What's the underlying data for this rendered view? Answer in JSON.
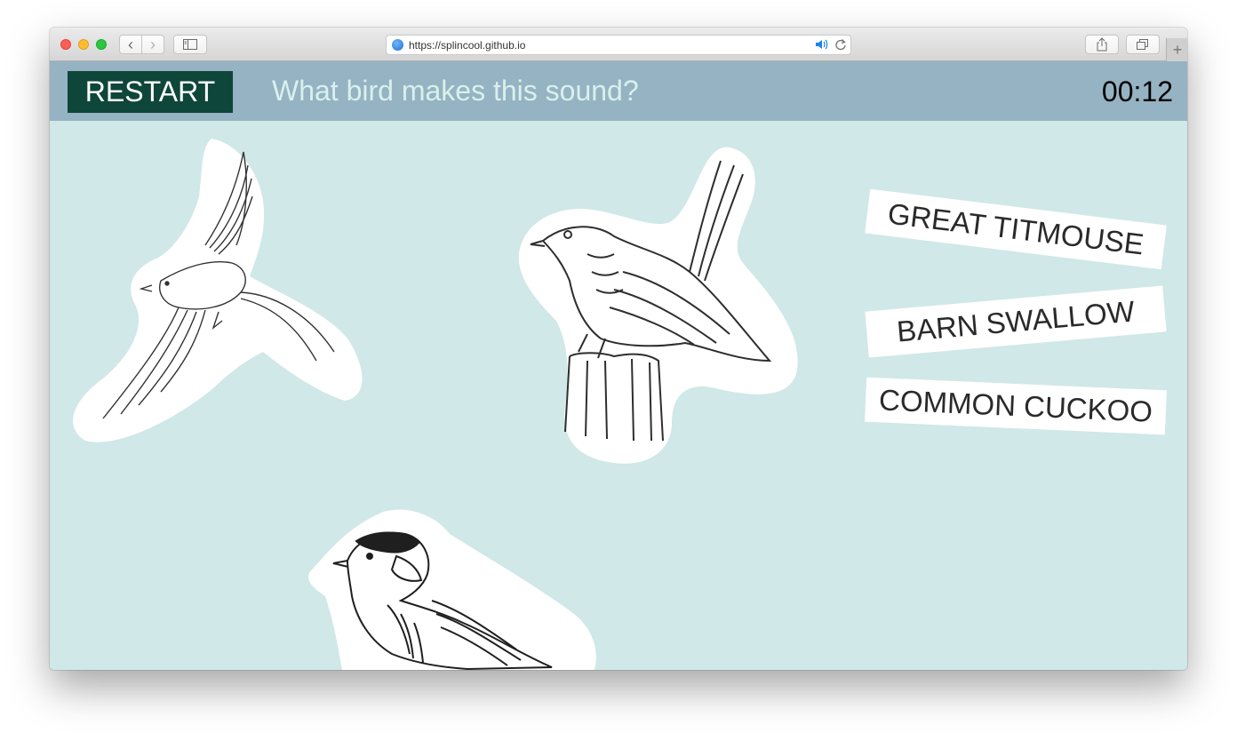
{
  "browser": {
    "url": "https://splincool.github.io",
    "back_glyph": "‹",
    "forward_glyph": "›",
    "new_tab_glyph": "+"
  },
  "header": {
    "restart_label": "RESTART",
    "question": "What bird makes this sound?",
    "timer": "00:12"
  },
  "answers": [
    {
      "label": "GREAT TITMOUSE"
    },
    {
      "label": "BARN SWALLOW"
    },
    {
      "label": "COMMON CUCKOO"
    }
  ],
  "birds": [
    {
      "icon": "swallow-illustration"
    },
    {
      "icon": "cuckoo-illustration"
    },
    {
      "icon": "titmouse-illustration"
    }
  ],
  "colors": {
    "header_bg": "#95b3c2",
    "restart_bg": "#0f463a",
    "content_bg": "#d0e8e7",
    "question_text": "#d9f0ec"
  }
}
